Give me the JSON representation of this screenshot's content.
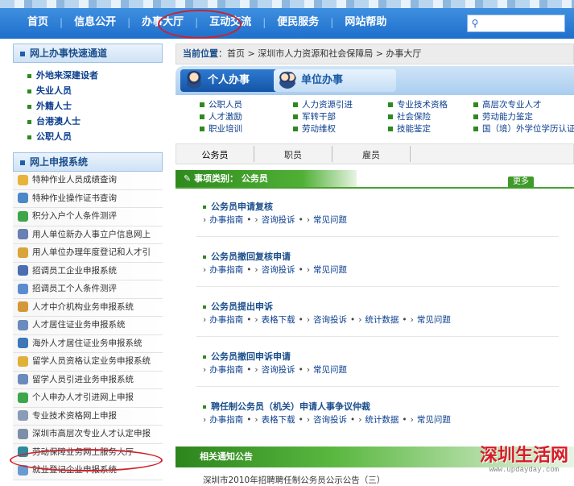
{
  "topnav": {
    "items": [
      "首页",
      "信息公开",
      "办事大厅",
      "互动交流",
      "便民服务",
      "网站帮助"
    ],
    "highlighted": "办事大厅",
    "highlight_color": "#d0202a"
  },
  "left": {
    "quick_title": "网上办事快速通道",
    "quick_links": [
      "外地来深建设者",
      "失业人员",
      "外籍人士",
      "台港澳人士",
      "公职人员"
    ],
    "system_title": "网上申报系统",
    "system_items": [
      "特种作业人员成绩查询",
      "特种作业操作证书查询",
      "积分入户个人条件测评",
      "用人单位新办人事立户信息网上",
      "用人单位办理年度登记和人才引",
      "招调员工企业申报系统",
      "招调员工个人条件测评",
      "人才中介机构业务申报系统",
      "人才居住证业务申报系统",
      "海外人才居住证业务申报系统",
      "留学人员资格认定业务申报系统",
      "留学人员引进业务申报系统",
      "个人申办人才引进网上申报",
      "专业技术资格网上申报",
      "深圳市高层次专业人才认定申报",
      "劳动保障业务网上服务大厅",
      "就业登记企业申报系统"
    ],
    "system_highlighted": "劳动保障业务网上服务大厅"
  },
  "main": {
    "breadcrumb_label": "当前位置",
    "breadcrumb_path": "：首页 > 深圳市人力资源和社会保障局 > 办事大厅",
    "tab_personal": "个人办事",
    "tab_unit": "单位办事",
    "links": [
      "公职人员",
      "人力资源引进",
      "专业技术资格",
      "高层次专业人才",
      "人才激励",
      "军转干部",
      "社会保险",
      "劳动能力鉴定",
      "职业培训",
      "劳动维权",
      "技能鉴定",
      "国（境）外学位学历认证"
    ],
    "subtabs": [
      "公务员",
      "职员",
      "雇员"
    ],
    "category_label": "事项类别：",
    "category_value": "公务员",
    "more": "更多",
    "items": [
      {
        "title": "公务员申请复核",
        "actions": [
          "办事指南",
          "咨询投诉",
          "常见问题"
        ]
      },
      {
        "title": "公务员撤回复核申请",
        "actions": [
          "办事指南",
          "咨询投诉",
          "常见问题"
        ]
      },
      {
        "title": "公务员提出申诉",
        "actions": [
          "办事指南",
          "表格下载",
          "咨询投诉",
          "统计数据",
          "常见问题"
        ]
      },
      {
        "title": "公务员撤回申诉申请",
        "actions": [
          "办事指南",
          "咨询投诉",
          "常见问题"
        ]
      },
      {
        "title": "聘任制公务员（机关）申请人事争议仲裁",
        "actions": [
          "办事指南",
          "表格下载",
          "咨询投诉",
          "统计数据",
          "常见问题"
        ]
      }
    ],
    "notice_title": "相关通知公告",
    "notice_first": "深圳市2010年招聘聘任制公务员公示公告（三）"
  },
  "watermark": {
    "text": "深圳生活网",
    "url": "www.updayday.com"
  }
}
